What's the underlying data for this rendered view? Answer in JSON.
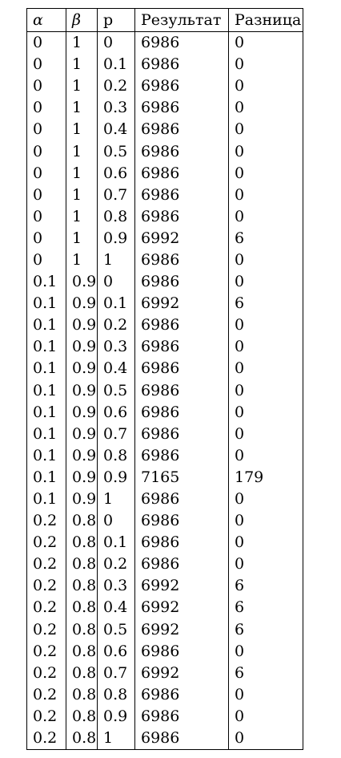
{
  "table": {
    "headers": [
      "α",
      "β",
      "p",
      "Результат",
      "Разница"
    ],
    "rows": [
      [
        "0",
        "1",
        "0",
        "6986",
        "0"
      ],
      [
        "0",
        "1",
        "0.1",
        "6986",
        "0"
      ],
      [
        "0",
        "1",
        "0.2",
        "6986",
        "0"
      ],
      [
        "0",
        "1",
        "0.3",
        "6986",
        "0"
      ],
      [
        "0",
        "1",
        "0.4",
        "6986",
        "0"
      ],
      [
        "0",
        "1",
        "0.5",
        "6986",
        "0"
      ],
      [
        "0",
        "1",
        "0.6",
        "6986",
        "0"
      ],
      [
        "0",
        "1",
        "0.7",
        "6986",
        "0"
      ],
      [
        "0",
        "1",
        "0.8",
        "6986",
        "0"
      ],
      [
        "0",
        "1",
        "0.9",
        "6992",
        "6"
      ],
      [
        "0",
        "1",
        "1",
        "6986",
        "0"
      ],
      [
        "0.1",
        "0.9",
        "0",
        "6986",
        "0"
      ],
      [
        "0.1",
        "0.9",
        "0.1",
        "6992",
        "6"
      ],
      [
        "0.1",
        "0.9",
        "0.2",
        "6986",
        "0"
      ],
      [
        "0.1",
        "0.9",
        "0.3",
        "6986",
        "0"
      ],
      [
        "0.1",
        "0.9",
        "0.4",
        "6986",
        "0"
      ],
      [
        "0.1",
        "0.9",
        "0.5",
        "6986",
        "0"
      ],
      [
        "0.1",
        "0.9",
        "0.6",
        "6986",
        "0"
      ],
      [
        "0.1",
        "0.9",
        "0.7",
        "6986",
        "0"
      ],
      [
        "0.1",
        "0.9",
        "0.8",
        "6986",
        "0"
      ],
      [
        "0.1",
        "0.9",
        "0.9",
        "7165",
        "179"
      ],
      [
        "0.1",
        "0.9",
        "1",
        "6986",
        "0"
      ],
      [
        "0.2",
        "0.8",
        "0",
        "6986",
        "0"
      ],
      [
        "0.2",
        "0.8",
        "0.1",
        "6986",
        "0"
      ],
      [
        "0.2",
        "0.8",
        "0.2",
        "6986",
        "0"
      ],
      [
        "0.2",
        "0.8",
        "0.3",
        "6992",
        "6"
      ],
      [
        "0.2",
        "0.8",
        "0.4",
        "6992",
        "6"
      ],
      [
        "0.2",
        "0.8",
        "0.5",
        "6992",
        "6"
      ],
      [
        "0.2",
        "0.8",
        "0.6",
        "6986",
        "0"
      ],
      [
        "0.2",
        "0.8",
        "0.7",
        "6992",
        "6"
      ],
      [
        "0.2",
        "0.8",
        "0.8",
        "6986",
        "0"
      ],
      [
        "0.2",
        "0.8",
        "0.9",
        "6986",
        "0"
      ],
      [
        "0.2",
        "0.8",
        "1",
        "6986",
        "0"
      ]
    ]
  }
}
